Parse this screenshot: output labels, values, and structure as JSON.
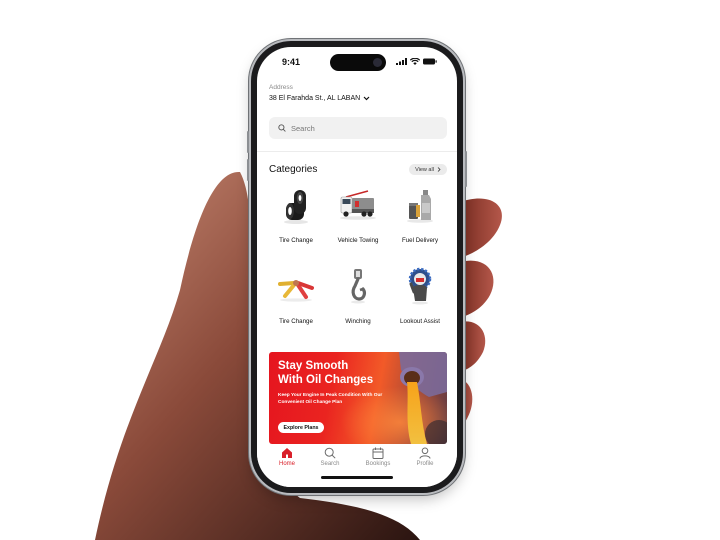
{
  "status_bar": {
    "time": "9:41",
    "icons": [
      "signal-icon",
      "wifi-icon",
      "battery-icon"
    ]
  },
  "address": {
    "label": "Address",
    "value": "38 El Farahda St., AL LABAN",
    "dropdown_icon": "chevron-down-icon"
  },
  "search": {
    "placeholder": "Search",
    "icon": "search-icon"
  },
  "categories": {
    "title": "Categories",
    "view_all_label": "View all",
    "items": [
      {
        "label": "Tire Change",
        "icon": "tires-icon"
      },
      {
        "label": "Vehicle Towing",
        "icon": "tow-truck-icon"
      },
      {
        "label": "Fuel Delivery",
        "icon": "fuel-can-icon"
      },
      {
        "label": "Tire Change",
        "icon": "jumper-cables-icon"
      },
      {
        "label": "Winching",
        "icon": "winch-hook-icon"
      },
      {
        "label": "Lookout Assist",
        "icon": "assist-gear-hand-icon"
      }
    ]
  },
  "banner": {
    "title_line1": "Stay Smooth",
    "title_line2": "With Oil Changes",
    "subtitle": "Keep Your Engine In Peak Condition With Our Convenient Oil Change Plan",
    "button_label": "Explore Plans"
  },
  "tabbar": {
    "items": [
      {
        "label": "Home",
        "icon": "home-icon",
        "active": true
      },
      {
        "label": "Search",
        "icon": "search-icon",
        "active": false
      },
      {
        "label": "Bookings",
        "icon": "calendar-icon",
        "active": false
      },
      {
        "label": "Profile",
        "icon": "user-icon",
        "active": false
      }
    ]
  },
  "colors": {
    "accent": "#d9202a",
    "inactive": "#8b8b8b",
    "banner_red": "#e5151f"
  }
}
